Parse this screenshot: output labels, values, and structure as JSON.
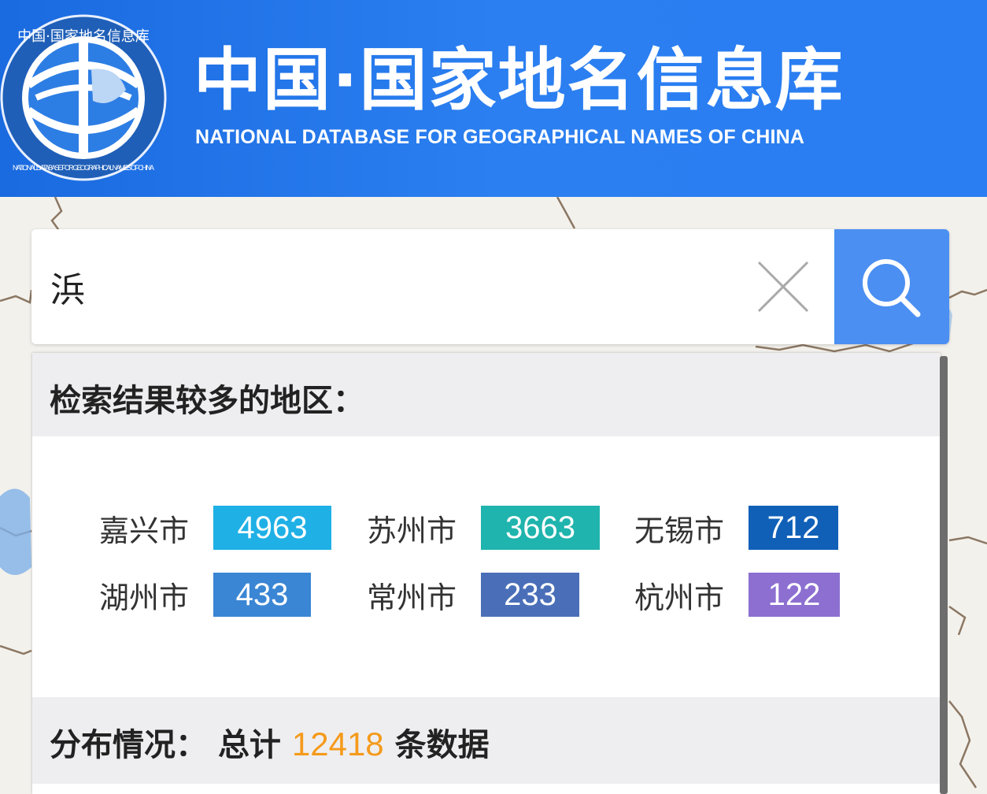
{
  "header": {
    "title_cn": "中国·国家地名信息库",
    "title_en": "NATIONAL DATABASE FOR GEOGRAPHICAL NAMES OF CHINA",
    "logo_top_text": "中国·国家地名信息库",
    "logo_bottom_text": "NATIONAL DATABASE FOR GEOGRAPHICAL NAMES OF CHINA",
    "bg_color": "#1f74ea"
  },
  "search": {
    "value": "浜",
    "clear_icon": "close-icon",
    "search_icon": "search-icon",
    "button_color": "#4b8ff2"
  },
  "results": {
    "heading": "检索结果较多的地区：",
    "regions": [
      {
        "name": "嘉兴市",
        "count": "4963",
        "color": "#1fb0e6"
      },
      {
        "name": "苏州市",
        "count": "3663",
        "color": "#1fb4ad"
      },
      {
        "name": "无锡市",
        "count": "712",
        "color": "#1060b8"
      },
      {
        "name": "湖州市",
        "count": "433",
        "color": "#3a86d4"
      },
      {
        "name": "常州市",
        "count": "233",
        "color": "#4a6fb8"
      },
      {
        "name": "杭州市",
        "count": "122",
        "color": "#8c6fd0"
      }
    ],
    "distribution_label": "分布情况：",
    "total_prefix": "总计",
    "total": "12418",
    "total_suffix": "条数据",
    "total_color": "#f59a1b"
  }
}
